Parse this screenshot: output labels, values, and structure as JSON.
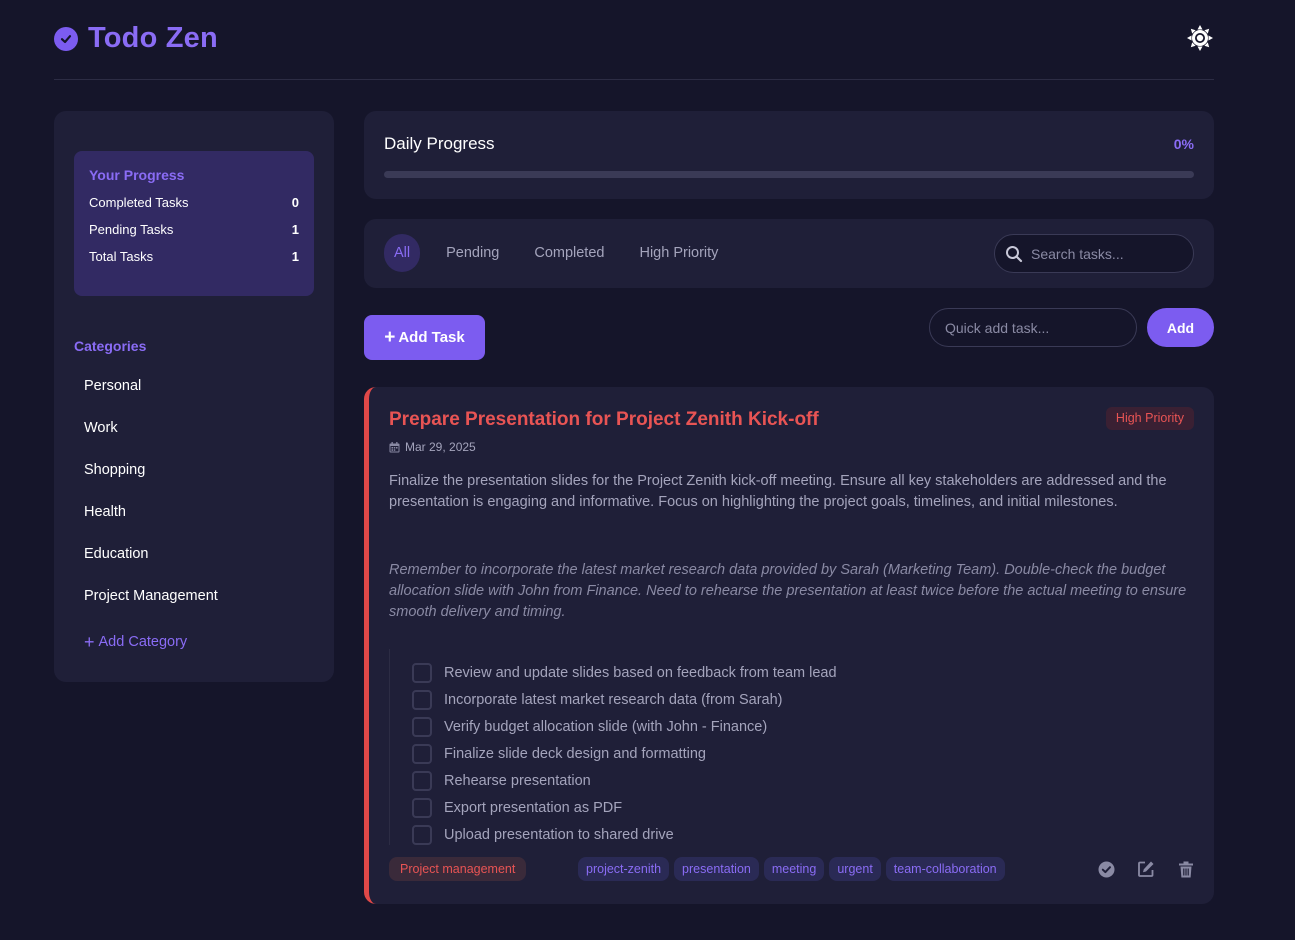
{
  "app": {
    "title": "Todo Zen"
  },
  "sidebar": {
    "progress": {
      "title": "Your Progress",
      "stats": [
        {
          "label": "Completed Tasks",
          "value": "0"
        },
        {
          "label": "Pending Tasks",
          "value": "1"
        },
        {
          "label": "Total Tasks",
          "value": "1"
        }
      ]
    },
    "categories_heading": "Categories",
    "categories": [
      "Personal",
      "Work",
      "Shopping",
      "Health",
      "Education",
      "Project Management"
    ],
    "add_category_label": "Add Category"
  },
  "daily_progress": {
    "title": "Daily Progress",
    "percent_label": "0%",
    "percent": 0
  },
  "filters": {
    "tabs": [
      "All",
      "Pending",
      "Completed",
      "High Priority"
    ],
    "active_tab": "All",
    "search_placeholder": "Search tasks..."
  },
  "actions": {
    "add_task_label": "Add Task",
    "quick_add_placeholder": "Quick add task...",
    "quick_add_button": "Add"
  },
  "task": {
    "title": "Prepare Presentation for Project Zenith Kick-off",
    "priority": "High Priority",
    "date": "Mar 29, 2025",
    "description": "Finalize the presentation slides for the Project Zenith kick-off meeting. Ensure all key stakeholders are addressed and the presentation is engaging and informative. Focus on highlighting the project goals, timelines, and initial milestones.",
    "notes": "Remember to incorporate the latest market research data provided by Sarah (Marketing Team). Double-check the budget allocation slide with John from Finance. Need to rehearse the presentation at least twice before the actual meeting to ensure smooth delivery and timing.",
    "subtasks": [
      "Review and update slides based on feedback from team lead",
      "Incorporate latest market research data (from Sarah)",
      "Verify budget allocation slide (with John - Finance)",
      "Finalize slide deck design and formatting",
      "Rehearse presentation",
      "Export presentation as PDF",
      "Upload presentation to shared drive"
    ],
    "category": "Project management",
    "tags": [
      "project-zenith",
      "presentation",
      "meeting",
      "urgent",
      "team-collaboration"
    ]
  },
  "colors": {
    "background": "#15152a",
    "panel": "#1f1f38",
    "accent": "#7c5cf0",
    "accent_text": "#8a6cf5",
    "danger": "#e85454"
  },
  "icons": {
    "logo": "check-circle-icon",
    "theme": "sun-icon",
    "search": "search-icon",
    "calendar": "calendar-icon",
    "complete": "check-circle-icon",
    "edit": "edit-icon",
    "delete": "trash-icon"
  }
}
